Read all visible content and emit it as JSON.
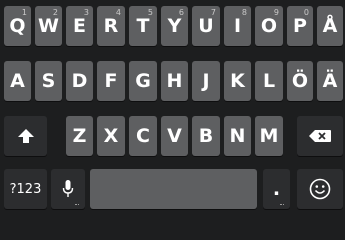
{
  "rows": [
    [
      {
        "label": "Q",
        "hint": "1"
      },
      {
        "label": "W",
        "hint": "2"
      },
      {
        "label": "E",
        "hint": "3"
      },
      {
        "label": "R",
        "hint": "4"
      },
      {
        "label": "T",
        "hint": "5"
      },
      {
        "label": "Y",
        "hint": "6"
      },
      {
        "label": "U",
        "hint": "7"
      },
      {
        "label": "I",
        "hint": "8"
      },
      {
        "label": "O",
        "hint": "9"
      },
      {
        "label": "P",
        "hint": "0"
      },
      {
        "label": "Å",
        "hint": ""
      }
    ],
    [
      {
        "label": "A"
      },
      {
        "label": "S"
      },
      {
        "label": "D"
      },
      {
        "label": "F"
      },
      {
        "label": "G"
      },
      {
        "label": "H"
      },
      {
        "label": "J"
      },
      {
        "label": "K"
      },
      {
        "label": "L"
      },
      {
        "label": "Ö"
      },
      {
        "label": "Ä"
      }
    ],
    [
      {
        "label": "Z"
      },
      {
        "label": "X"
      },
      {
        "label": "C"
      },
      {
        "label": "V"
      },
      {
        "label": "B"
      },
      {
        "label": "N"
      },
      {
        "label": "M"
      }
    ]
  ],
  "bottom": {
    "symbols_label": "?123",
    "period_label": "."
  },
  "icons": {
    "shift": "shift-arrow-icon",
    "backspace": "backspace-icon",
    "mic": "microphone-icon",
    "emoji": "smiley-icon"
  },
  "colors": {
    "background": "#1d1e1f",
    "key": "#5e5f61",
    "key_dark": "#2c2d2f",
    "text": "#ffffff"
  }
}
